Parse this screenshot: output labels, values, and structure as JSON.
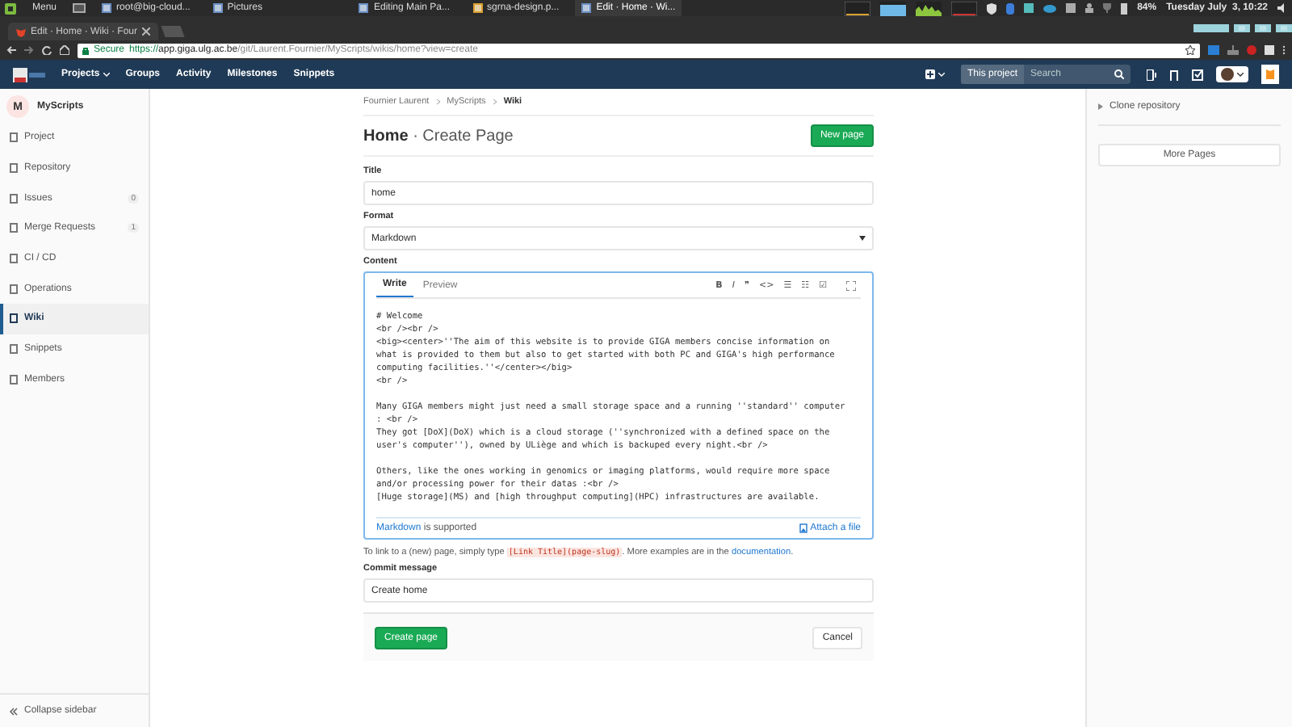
{
  "taskbar": {
    "menu": "Menu",
    "windows": [
      {
        "label": "root@big-cloud...",
        "selected": false
      },
      {
        "label": "Pictures",
        "selected": false
      },
      {
        "label": "Editing Main Pa...",
        "selected": false
      },
      {
        "label": "sgrna-design.p...",
        "selected": false
      },
      {
        "label": "Edit · Home · Wi...",
        "selected": true
      }
    ],
    "battery": "84%",
    "clock": "Tuesday July  3, 10:22"
  },
  "browser": {
    "tab": "Edit · Home · Wiki · Four",
    "secure": "Secure",
    "url_scheme": "https://",
    "url_host": "app.giga.ulg.ac.be",
    "url_path": "/git/Laurent.Fournier/MyScripts/wikis/home?view=create"
  },
  "navbar": {
    "items": [
      {
        "label": "Projects",
        "dropdown": true
      },
      {
        "label": "Groups",
        "dropdown": false
      },
      {
        "label": "Activity",
        "dropdown": false
      },
      {
        "label": "Milestones",
        "dropdown": false
      },
      {
        "label": "Snippets",
        "dropdown": false
      }
    ],
    "scope": "This project",
    "search": {
      "placeholder": "Search"
    }
  },
  "sidebar": {
    "project": {
      "initial": "M",
      "name": "MyScripts"
    },
    "items": [
      {
        "label": "Project",
        "selected": false
      },
      {
        "label": "Repository",
        "selected": false
      },
      {
        "label": "Issues",
        "count": "0",
        "selected": false
      },
      {
        "label": "Merge Requests",
        "count": "1",
        "selected": false
      },
      {
        "label": "CI / CD",
        "selected": false
      },
      {
        "label": "Operations",
        "selected": false
      },
      {
        "label": "Wiki",
        "selected": true
      },
      {
        "label": "Snippets",
        "selected": false
      },
      {
        "label": "Members",
        "selected": false
      }
    ],
    "collapse": "Collapse sidebar"
  },
  "breadcrumbs": [
    "Fournier Laurent",
    "MyScripts",
    "Wiki"
  ],
  "heading": {
    "title": "Home",
    "subtitle": "· Create Page",
    "new_page": "New page"
  },
  "form": {
    "title_label": "Title",
    "title_value": "home",
    "format_label": "Format",
    "format_value": "Markdown",
    "content_label": "Content",
    "editor_tabs": [
      {
        "label": "Write",
        "selected": true
      },
      {
        "label": "Preview",
        "selected": false
      }
    ],
    "toolbar": [
      "B",
      "I",
      "❞",
      "<>",
      "☰",
      "☷",
      "☑"
    ],
    "content_paragraphs": [
      [
        "# Welcome",
        "<br /><br />",
        "<big><center>''The aim of this website is to provide GIGA members concise information on",
        "what is provided to them but also to get started with both PC and GIGA's high performance",
        "computing facilities.''</center></big>",
        "<br />"
      ],
      [
        "Many GIGA members might just need a small storage space and a running ''standard'' computer",
        ": <br />",
        "They got [DoX](DoX) which is a cloud storage (''synchronized with a defined space on the",
        "user's computer''), owned by ULiège and which is backuped every night.<br />"
      ],
      [
        "Others, like the ones working in genomics or imaging platforms, would require more space",
        "and/or processing power for their datas :<br />",
        "[Huge storage](MS) and [high throughput computing](HPC) infrastructures are available."
      ]
    ],
    "markdown_link": "Markdown",
    "markdown_note": " is supported",
    "attach": "Attach a file",
    "help": {
      "before": "To link to a (new) page, simply type ",
      "code": "[Link Title](page-slug)",
      "middle": ". More examples are in the ",
      "link": "documentation",
      "after": "."
    },
    "commit_label": "Commit message",
    "commit_value": "Create home",
    "submit": "Create page",
    "cancel": "Cancel"
  },
  "right": {
    "clone": "Clone repository",
    "more_pages": "More Pages"
  }
}
